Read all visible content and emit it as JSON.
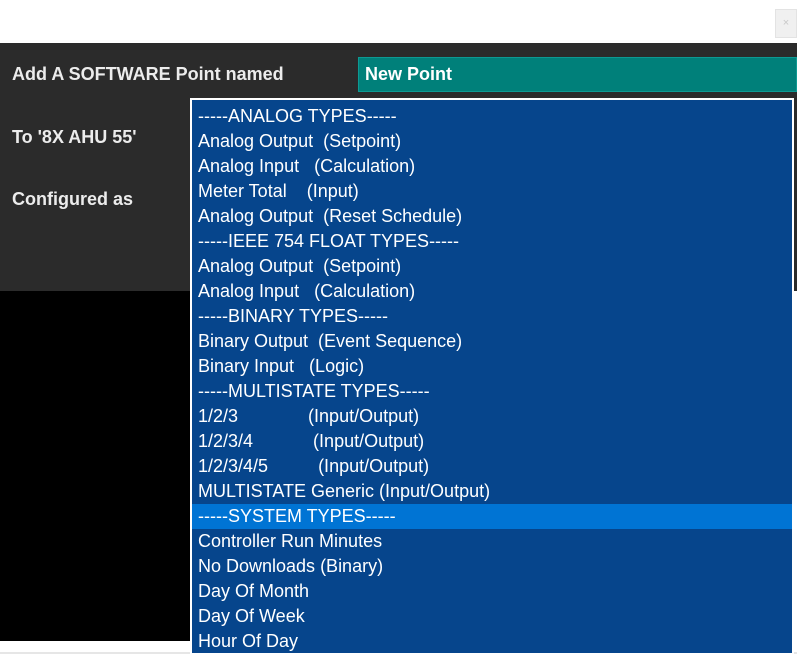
{
  "dialog": {
    "close_glyph": "×",
    "add_label": "Add A SOFTWARE Point named",
    "point_name_value": "New Point",
    "to_label": "To '8X AHU 55'",
    "configured_label": "Configured as"
  },
  "type_list": {
    "options": [
      "-----ANALOG TYPES-----",
      "Analog Output  (Setpoint)",
      "Analog Input   (Calculation)",
      "Meter Total    (Input)",
      "Analog Output  (Reset Schedule)",
      "-----IEEE 754 FLOAT TYPES-----",
      "Analog Output  (Setpoint)",
      "Analog Input   (Calculation)",
      "-----BINARY TYPES-----",
      "Binary Output  (Event Sequence)",
      "Binary Input   (Logic)",
      "-----MULTISTATE TYPES-----",
      "1/2/3              (Input/Output)",
      "1/2/3/4            (Input/Output)",
      "1/2/3/4/5          (Input/Output)",
      "MULTISTATE Generic (Input/Output)",
      "-----SYSTEM TYPES-----",
      "Controller Run Minutes",
      "No Downloads (Binary)",
      "Day Of Month",
      "Day Of Week",
      "Hour Of Day"
    ],
    "selected_index": 16
  },
  "colors": {
    "panel_bg": "#2b2b2b",
    "field_bg": "#00807a",
    "list_bg": "#06458c",
    "selected_bg": "#0074d4"
  }
}
